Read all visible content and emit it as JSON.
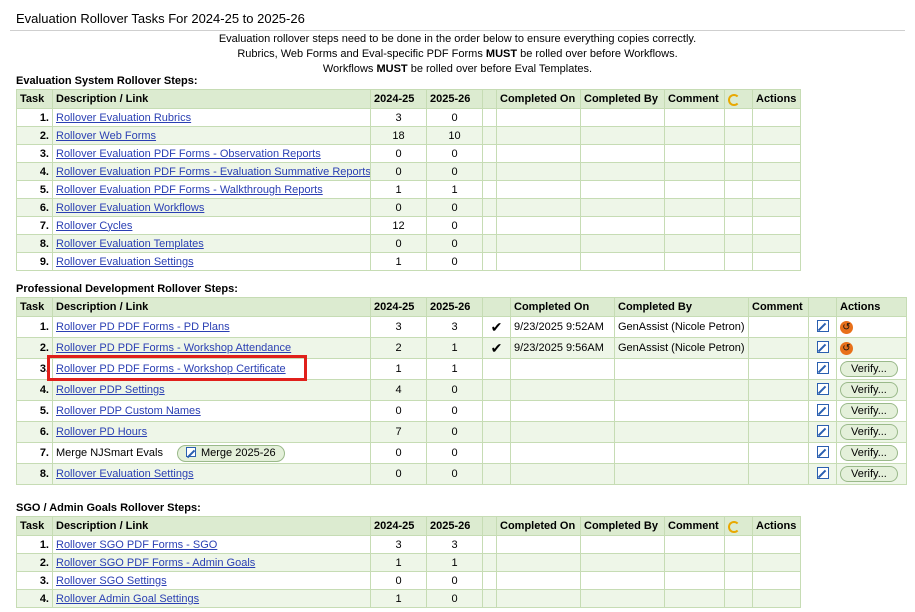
{
  "page": {
    "title": "Evaluation Rollover Tasks For 2024-25 to 2025-26",
    "intro_line1": "Evaluation rollover steps need to be done in the order below to ensure everything copies correctly.",
    "intro_line2_pre": "Rubrics, Web Forms and Eval-specific PDF Forms ",
    "intro_must": "MUST",
    "intro_line2_post": " be rolled over before Workflows.",
    "intro_line3_pre": "Workflows ",
    "intro_line3_post": " be rolled over before Eval Templates."
  },
  "headers": {
    "task": "Task",
    "desc": "Description / Link",
    "y1": "2024-25",
    "y2": "2025-26",
    "completed_on": "Completed On",
    "completed_by": "Completed By",
    "comment": "Comment",
    "actions": "Actions",
    "google_icon": "G-icon"
  },
  "eval": {
    "heading": "Evaluation System Rollover Steps:",
    "rows": [
      {
        "n": "1.",
        "label": "Rollover Evaluation Rubrics",
        "a": "3",
        "b": "0"
      },
      {
        "n": "2.",
        "label": "Rollover Web Forms",
        "a": "18",
        "b": "10"
      },
      {
        "n": "3.",
        "label": "Rollover Evaluation PDF Forms - Observation Reports",
        "a": "0",
        "b": "0"
      },
      {
        "n": "4.",
        "label": "Rollover Evaluation PDF Forms - Evaluation Summative Reports",
        "a": "0",
        "b": "0"
      },
      {
        "n": "5.",
        "label": "Rollover Evaluation PDF Forms - Walkthrough Reports",
        "a": "1",
        "b": "1"
      },
      {
        "n": "6.",
        "label": "Rollover Evaluation Workflows",
        "a": "0",
        "b": "0"
      },
      {
        "n": "7.",
        "label": "Rollover Cycles",
        "a": "12",
        "b": "0"
      },
      {
        "n": "8.",
        "label": "Rollover Evaluation Templates",
        "a": "0",
        "b": "0"
      },
      {
        "n": "9.",
        "label": "Rollover Evaluation Settings",
        "a": "1",
        "b": "0"
      }
    ]
  },
  "pd": {
    "heading": "Professional Development Rollover Steps:",
    "verify_label": "Verify...",
    "merge_label": "Merge 2025-26",
    "rows": [
      {
        "n": "1.",
        "label": "Rollover PD PDF Forms - PD Plans",
        "a": "3",
        "b": "3",
        "check": "✔",
        "on": "9/23/2025 9:52AM",
        "by": "GenAssist (Nicole Petron)"
      },
      {
        "n": "2.",
        "label": "Rollover PD PDF Forms - Workshop Attendance",
        "a": "2",
        "b": "1",
        "check": "✔",
        "on": "9/23/2025 9:56AM",
        "by": "GenAssist (Nicole Petron)"
      },
      {
        "n": "3.",
        "label": "Rollover PD PDF Forms - Workshop Certificate",
        "a": "1",
        "b": "1",
        "check": "",
        "on": "",
        "by": ""
      },
      {
        "n": "4.",
        "label": "Rollover PDP Settings",
        "a": "4",
        "b": "0",
        "check": "",
        "on": "",
        "by": ""
      },
      {
        "n": "5.",
        "label": "Rollover PDP Custom Names",
        "a": "0",
        "b": "0",
        "check": "",
        "on": "",
        "by": ""
      },
      {
        "n": "6.",
        "label": "Rollover PD Hours",
        "a": "7",
        "b": "0",
        "check": "",
        "on": "",
        "by": ""
      },
      {
        "n": "7.",
        "label": "Merge NJSmart Evals",
        "a": "0",
        "b": "0",
        "check": "",
        "on": "",
        "by": ""
      },
      {
        "n": "8.",
        "label": "Rollover Evaluation Settings",
        "a": "0",
        "b": "0",
        "check": "",
        "on": "",
        "by": ""
      }
    ]
  },
  "sgo": {
    "heading": "SGO / Admin Goals Rollover Steps:",
    "rows": [
      {
        "n": "1.",
        "label": "Rollover SGO PDF Forms - SGO",
        "a": "3",
        "b": "3"
      },
      {
        "n": "2.",
        "label": "Rollover SGO PDF Forms - Admin Goals",
        "a": "1",
        "b": "1"
      },
      {
        "n": "3.",
        "label": "Rollover SGO Settings",
        "a": "0",
        "b": "0"
      },
      {
        "n": "4.",
        "label": "Rollover Admin Goal Settings",
        "a": "1",
        "b": "0"
      }
    ]
  }
}
